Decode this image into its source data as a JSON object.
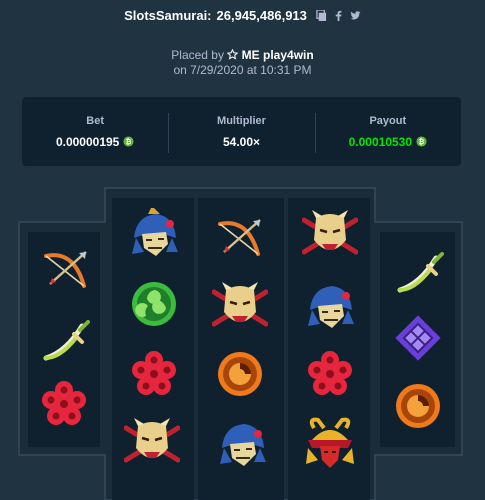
{
  "header": {
    "game_name": "SlotsSamurai:",
    "bet_id": "26,945,486,913"
  },
  "placed": {
    "prefix": "Placed by",
    "username": "ME play4win",
    "date_line": "on 7/29/2020 at 10:31 PM"
  },
  "stats": {
    "bet_label": "Bet",
    "bet_value": "0.00000195",
    "multiplier_label": "Multiplier",
    "multiplier_value": "54.00×",
    "payout_label": "Payout",
    "payout_value": "0.00010530"
  },
  "colors": {
    "background": "#203341",
    "panel": "#0f212e",
    "payout_green": "#00e701",
    "coin": "#5fb639"
  },
  "reels": [
    [
      "bow-arrow",
      "crossed-swords",
      "plum-blossom"
    ],
    [
      "samurai-helmet",
      "green-tomoe",
      "plum-blossom",
      "oni-mask"
    ],
    [
      "bow-arrow",
      "oni-mask",
      "orange-tomoe",
      "samurai-helmet"
    ],
    [
      "oni-mask",
      "samurai-helmet",
      "plum-blossom",
      "kabuto-armor"
    ],
    [
      "crossed-swords",
      "purple-diamond",
      "orange-tomoe"
    ]
  ]
}
